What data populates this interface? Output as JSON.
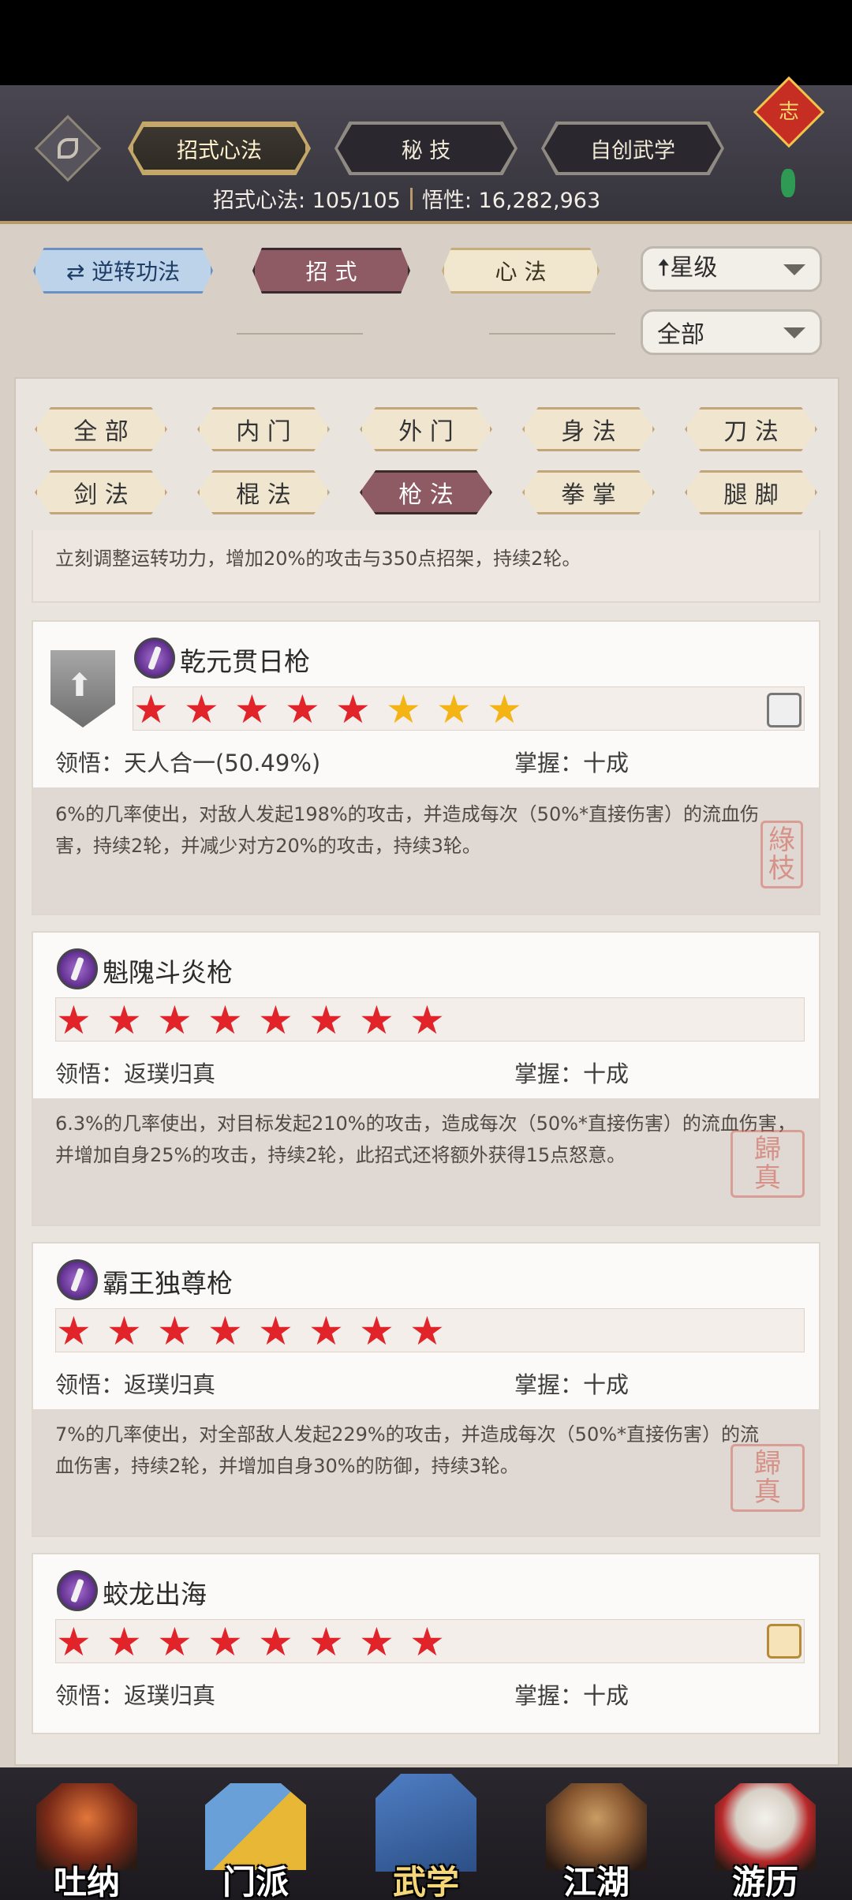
{
  "header": {
    "tabs": [
      {
        "label": "招式心法",
        "active": true
      },
      {
        "label": "秘 技",
        "active": false
      },
      {
        "label": "自创武学",
        "active": false
      }
    ],
    "summary_label": "招式心法: 105/105",
    "insight_label": "悟性: 16,282,963",
    "knot_glyph": "志"
  },
  "filters": {
    "reverse_button": "⇄ 逆转功法",
    "type_tabs": [
      {
        "label": "招 式",
        "active": true
      },
      {
        "label": "心 法",
        "active": false
      }
    ],
    "sort_dropdown": "🠅星级",
    "scope_dropdown": "全部"
  },
  "categories": [
    {
      "label": "全 部",
      "active": false
    },
    {
      "label": "内 门",
      "active": false
    },
    {
      "label": "外 门",
      "active": false
    },
    {
      "label": "身 法",
      "active": false
    },
    {
      "label": "刀 法",
      "active": false
    },
    {
      "label": "剑 法",
      "active": false
    },
    {
      "label": "棍 法",
      "active": false
    },
    {
      "label": "枪 法",
      "active": true
    },
    {
      "label": "拳 掌",
      "active": false
    },
    {
      "label": "腿 脚",
      "active": false
    }
  ],
  "partial_card": {
    "desc": "立刻调整运转功力，增加20%的攻击与350点招架，持续2轮。"
  },
  "skills": [
    {
      "name": "乾元贯日枪",
      "stars_total": 8,
      "stars_red": 5,
      "comprehension": "领悟：天人合一(50.49%)",
      "mastery": "掌握：十成",
      "desc": "6%的几率使出，对敌人发起198%的攻击，并造成每次（50%*直接伤害）的流血伤害，持续2轮，并减少对方20%的攻击，持续3轮。",
      "seal": "綠枝"
    },
    {
      "name": "魁隗斗炎枪",
      "stars_total": 8,
      "stars_red": 8,
      "comprehension": "领悟：返璞归真",
      "mastery": "掌握：十成",
      "desc": "6.3%的几率使出，对目标发起210%的攻击，造成每次（50%*直接伤害）的流血伤害，并增加自身25%的攻击，持续2轮，此招式还将额外获得15点怒意。",
      "seal": "歸真"
    },
    {
      "name": "霸王独尊枪",
      "stars_total": 8,
      "stars_red": 8,
      "comprehension": "领悟：返璞归真",
      "mastery": "掌握：十成",
      "desc": "7%的几率使出，对全部敌人发起229%的攻击，并造成每次（50%*直接伤害）的流血伤害，持续2轮，并增加自身30%的防御，持续3轮。",
      "seal": "歸真"
    },
    {
      "name": "蛟龙出海",
      "stars_total": 8,
      "stars_red": 8,
      "comprehension": "领悟：返璞归真",
      "mastery": "掌握：十成"
    }
  ],
  "bottom_nav": [
    {
      "label": "吐纳",
      "active": false
    },
    {
      "label": "门派",
      "active": false
    },
    {
      "label": "武学",
      "active": true
    },
    {
      "label": "江湖",
      "active": false
    },
    {
      "label": "游历",
      "active": false
    }
  ]
}
